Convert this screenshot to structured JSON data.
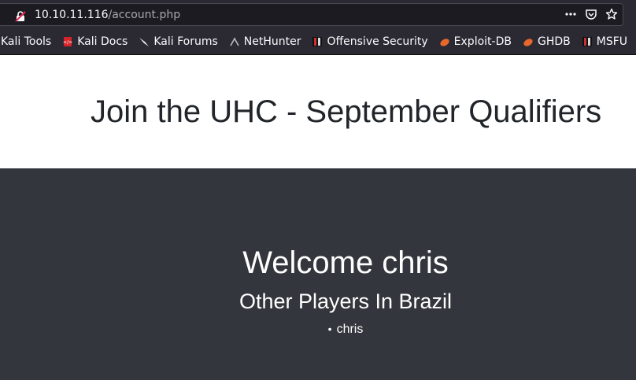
{
  "browser": {
    "url_host": "10.10.11.116",
    "url_path": "/account.php"
  },
  "bookmarks": [
    {
      "label": "Kali Tools",
      "icon": "kali-icon"
    },
    {
      "label": "Kali Docs",
      "icon": "kali-docs-icon"
    },
    {
      "label": "Kali Forums",
      "icon": "kali-forums-icon"
    },
    {
      "label": "NetHunter",
      "icon": "nethunter-icon"
    },
    {
      "label": "Offensive Security",
      "icon": "offsec-icon"
    },
    {
      "label": "Exploit-DB",
      "icon": "exploitdb-icon"
    },
    {
      "label": "GHDB",
      "icon": "ghdb-icon"
    },
    {
      "label": "MSFU",
      "icon": "msfu-icon"
    }
  ],
  "page": {
    "title": "Join the UHC - September Qualifiers",
    "welcome": "Welcome chris",
    "subheading": "Other Players In Brazil",
    "players": [
      "chris"
    ]
  }
}
